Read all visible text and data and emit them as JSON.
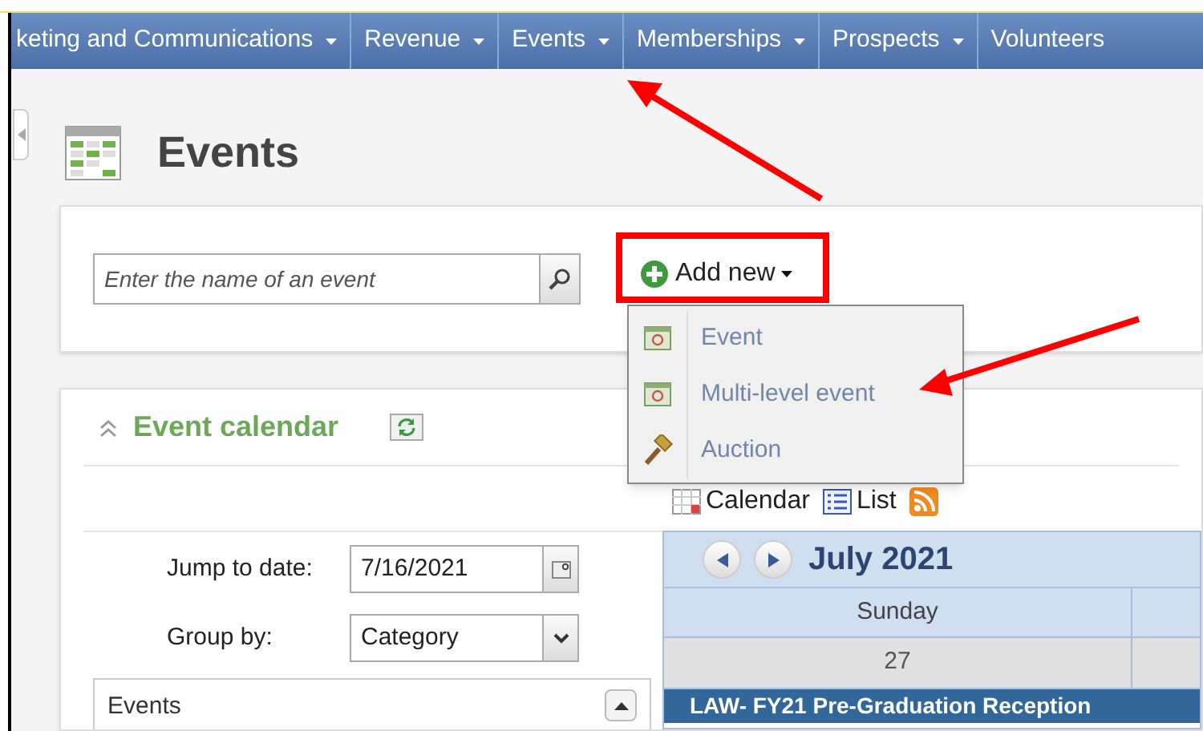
{
  "nav": {
    "items": [
      {
        "label": "keting and Communications",
        "caret": true
      },
      {
        "label": "Revenue",
        "caret": true
      },
      {
        "label": "Events",
        "caret": true
      },
      {
        "label": "Memberships",
        "caret": true
      },
      {
        "label": "Prospects",
        "caret": true
      },
      {
        "label": "Volunteers",
        "caret": false
      }
    ]
  },
  "page": {
    "title": "Events"
  },
  "search": {
    "placeholder": "Enter the name of an event"
  },
  "add_new": {
    "label": "Add new",
    "expanded": true,
    "menu": [
      {
        "label": "Event",
        "kind": "event"
      },
      {
        "label": "Multi-level event",
        "kind": "event"
      },
      {
        "label": "Auction",
        "kind": "auction"
      }
    ]
  },
  "calendar_panel": {
    "title": "Event calendar",
    "expanded": true,
    "jump_to_date": {
      "label": "Jump to date:",
      "value": "7/16/2021"
    },
    "group_by": {
      "label": "Group by:",
      "value": "Category"
    },
    "events_list": {
      "header": "Events"
    },
    "views": [
      {
        "label": "Calendar",
        "kind": "calendar"
      },
      {
        "label": "List",
        "kind": "list"
      },
      {
        "kind": "rss"
      }
    ],
    "calendar": {
      "month": "July 2021",
      "day_header": "Sunday",
      "date": "27",
      "event": "LAW- FY21 Pre-Graduation Reception"
    }
  }
}
